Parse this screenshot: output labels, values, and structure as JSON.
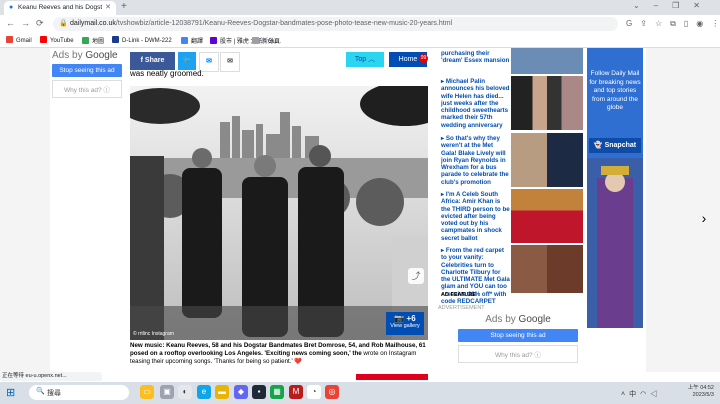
{
  "browser": {
    "tab_title": "Keanu Reeves and his Dogstar",
    "url_host": "dailymail.co.uk",
    "url_path": "/tvshowbiz/article-12038791/Keanu-Reeves-Dogstar-bandmates-pose-photo-tease-new-music-20-years.html",
    "bookmarks": [
      "Gmail",
      "YouTube",
      "地圖",
      "D-Link - DWM-222",
      "翻譯",
      "股市 | 雅虎 大紙 - Ou...",
      "新分頁"
    ]
  },
  "ads_left": {
    "ads_by": "Ads by",
    "google": "Google",
    "stop": "Stop seeing this ad",
    "why": "Why this ad? ⓘ"
  },
  "share": {
    "share_label": "Share",
    "top_label": "Top",
    "home_label": "Home",
    "home_badge": "99"
  },
  "article": {
    "intro_text": "was neatly groomed.",
    "photo_credit": "© rrtlinc Instagram",
    "gallery_count": "+6",
    "gallery_label": "View gallery",
    "caption_bold": "New music: Keanu Reeves, 58 and his Dogstar Bandmates Bret Domrose, 54, and Rob Mailhouse, 61 posed on a rooftop overlooking Los Angeles. 'Exciting news coming soon,' the",
    "caption_rest": "wrote on Instagram teasing their upcoming songs. 'Thanks for being so patient.' ❤️"
  },
  "sidebar": {
    "stories": [
      {
        "text": "purchasing their 'dream' Essex mansion"
      },
      {
        "text": "Michael Palin announces his beloved wife Helen has died... just weeks after the childhood sweethearts marked their 57th wedding anniversary"
      },
      {
        "text": "So that's why they weren't at the Met Gala! Blake Lively will join Ryan Reynolds in Wrexham for a bus parade to celebrate the club's promotion"
      },
      {
        "text": "I'm A Celeb South Africa: Amir Khan is the THIRD person to be evicted after being voted out by his campmates in shock secret ballot"
      },
      {
        "text": "From the red carpet to your vanity: Celebrities turn to Charlotte Tilbury for the ULTIMATE Met Gala glam and YOU can too - receive 20% off* with code REDCARPET"
      }
    ],
    "ad_feature": "AD FEATURE",
    "advertisement": "ADVERTISEMENT"
  },
  "ads_right": {
    "ads_by": "Ads by",
    "google": "Google",
    "stop": "Stop seeing this ad",
    "why": "Why this ad? ⓘ"
  },
  "snap_ad": {
    "text": "Follow Daily Mail for breaking news and top stories from around the globe",
    "button": "Snapchat"
  },
  "status_text": "正在等待 eu-u.openx.net...",
  "taskbar": {
    "search_placeholder": "搜尋",
    "time": "上午 04:52",
    "date": "2023/5/3",
    "ime": "中"
  }
}
